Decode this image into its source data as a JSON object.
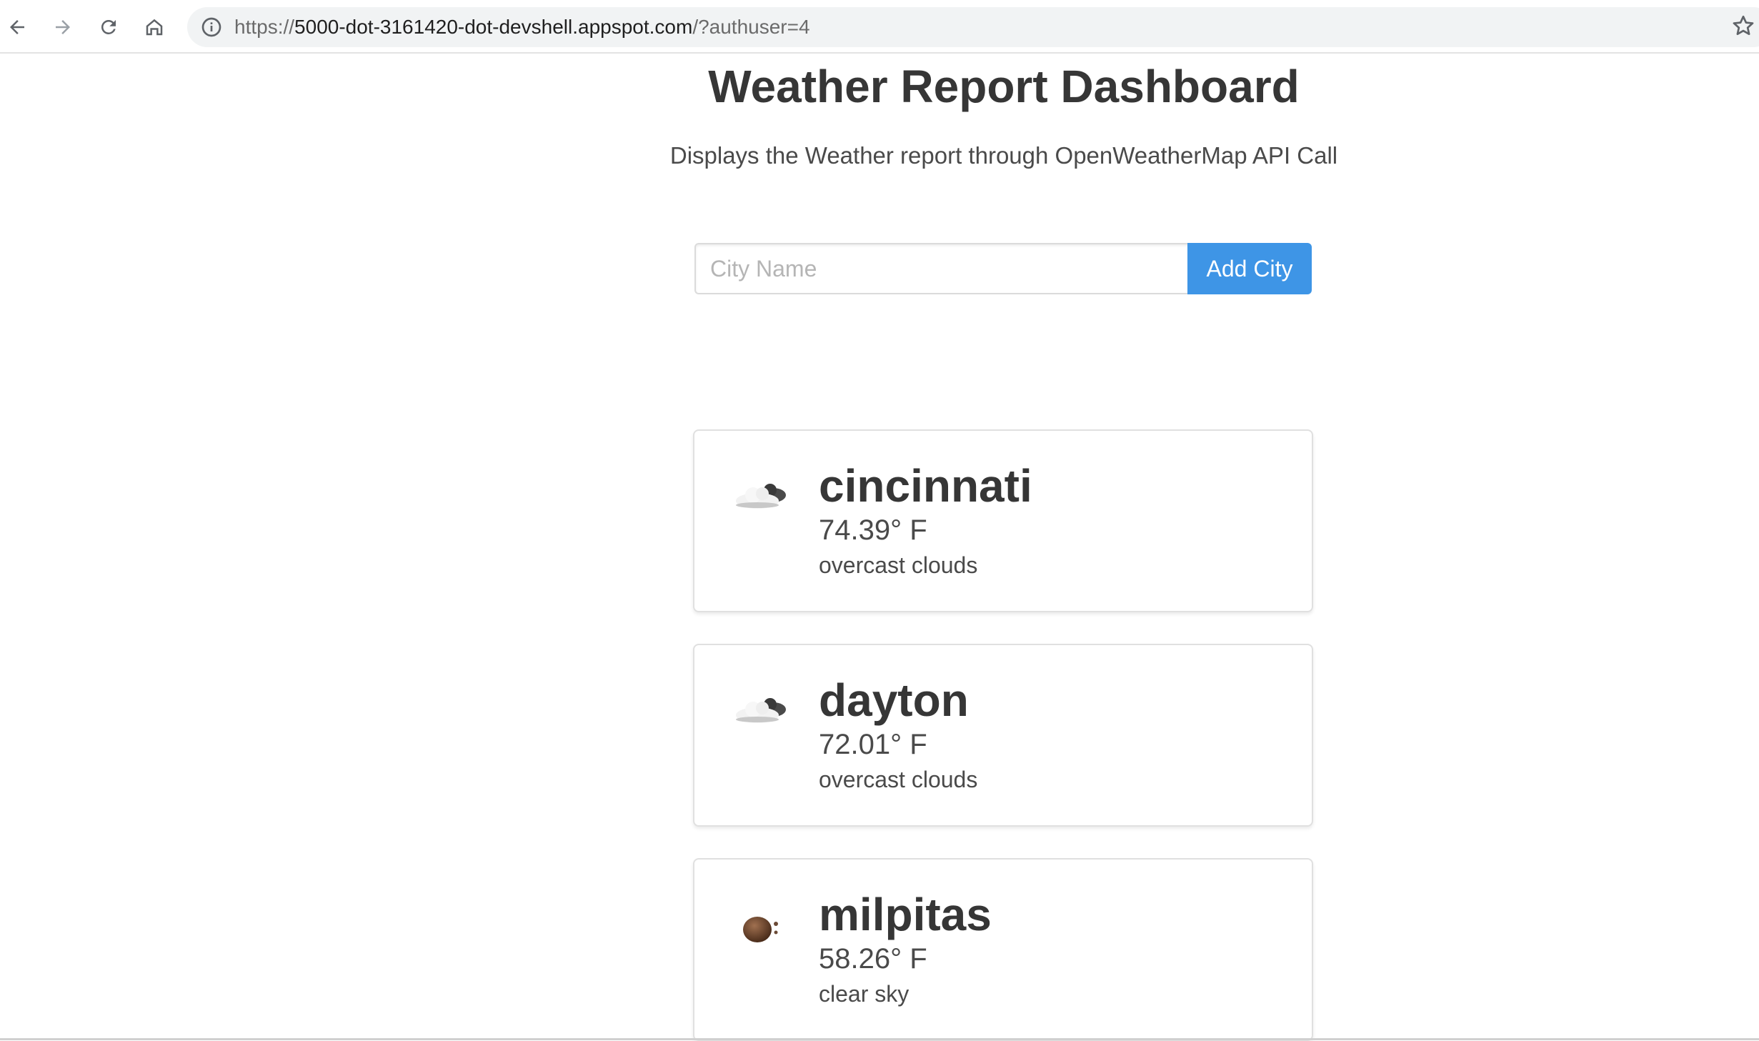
{
  "browser": {
    "url_prefix": "https://",
    "url_host": "5000-dot-3161420-dot-devshell.appspot.com",
    "url_path": "/?authuser=4",
    "icons": [
      "back-icon",
      "forward-icon",
      "reload-icon",
      "home-icon",
      "info-icon",
      "star-icon"
    ]
  },
  "page": {
    "title": "Weather Report Dashboard",
    "subtitle": "Displays the Weather report through OpenWeatherMap API Call"
  },
  "form": {
    "placeholder": "City Name",
    "button_label": "Add City",
    "button_color": "#3e95e6"
  },
  "cities": [
    {
      "name": "cincinnati",
      "temp": "74.39° F",
      "description": "overcast clouds",
      "icon": "overcast-clouds-icon"
    },
    {
      "name": "dayton",
      "temp": "72.01° F",
      "description": "overcast clouds",
      "icon": "overcast-clouds-icon"
    },
    {
      "name": "milpitas",
      "temp": "58.26° F",
      "description": "clear sky",
      "icon": "clear-sky-night-icon"
    }
  ]
}
